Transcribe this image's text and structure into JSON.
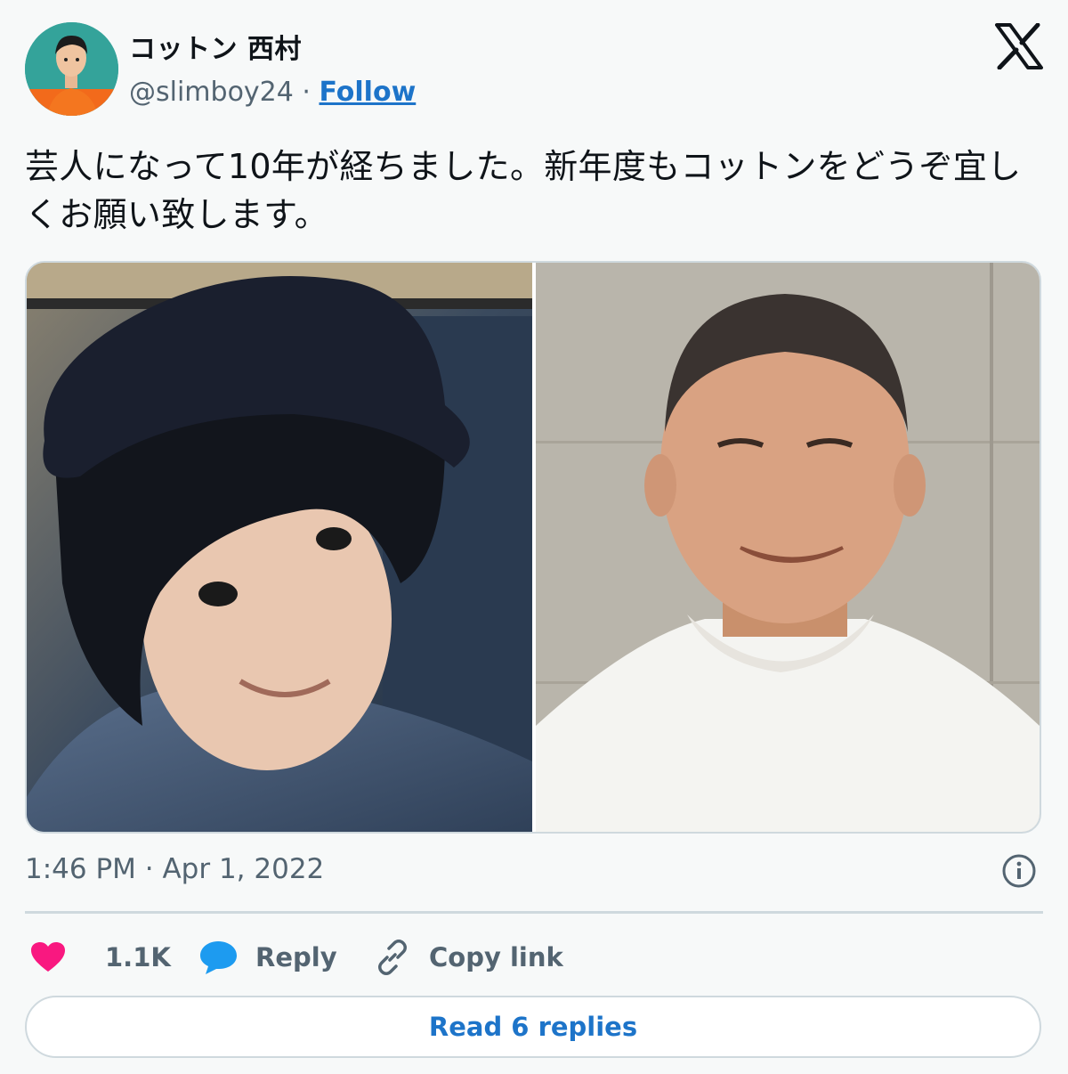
{
  "author": {
    "display_name": "コットン 西村",
    "handle": "@slimboy24",
    "separator": "·",
    "follow_label": "Follow"
  },
  "tweet": {
    "text": "芸人になって10年が経ちました。新年度もコットンをどうぞ宜しくお願い致します。",
    "timestamp": "1:46 PM · Apr 1, 2022"
  },
  "actions": {
    "like_count": "1.1K",
    "reply_label": "Reply",
    "copy_link_label": "Copy link",
    "read_replies_label": "Read 6 replies"
  },
  "colors": {
    "accent": "#1d74c9",
    "heart": "#f91880",
    "reply_bubble": "#1d9bf0",
    "muted_text": "#536471"
  },
  "icons": {
    "logo": "x-logo-icon",
    "like": "heart-icon",
    "reply": "speech-bubble-icon",
    "copy": "link-icon",
    "info": "info-icon"
  }
}
